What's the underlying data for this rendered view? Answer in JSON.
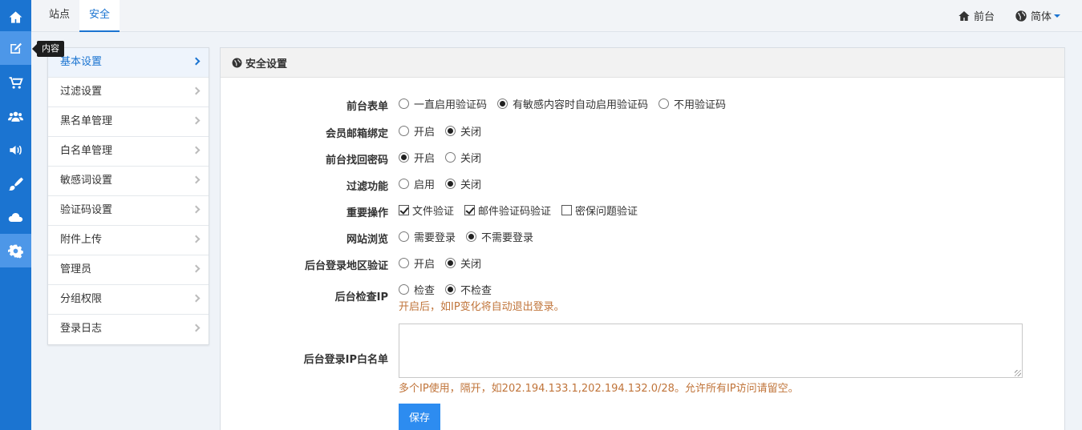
{
  "sidebar": {
    "icons": [
      "home-icon",
      "edit-icon",
      "cart-icon",
      "users-icon",
      "volume-icon",
      "brush-icon",
      "cloud-icon",
      "gear-icon"
    ],
    "tooltip": "内容"
  },
  "topbar": {
    "tabs": [
      {
        "label": "站点"
      },
      {
        "label": "安全"
      }
    ],
    "frontend": "前台",
    "language": "简体"
  },
  "submenu": {
    "items": [
      {
        "label": "基本设置"
      },
      {
        "label": "过滤设置"
      },
      {
        "label": "黑名单管理"
      },
      {
        "label": "白名单管理"
      },
      {
        "label": "敏感词设置"
      },
      {
        "label": "验证码设置"
      },
      {
        "label": "附件上传"
      },
      {
        "label": "管理员"
      },
      {
        "label": "分组权限"
      },
      {
        "label": "登录日志"
      }
    ]
  },
  "panel": {
    "title": "安全设置",
    "rows": [
      {
        "label": "前台表单",
        "options": [
          "一直启用验证码",
          "有敏感内容时自动启用验证码",
          "不用验证码"
        ],
        "selected": 1
      },
      {
        "label": "会员邮箱绑定",
        "options": [
          "开启",
          "关闭"
        ],
        "selected": 1
      },
      {
        "label": "前台找回密码",
        "options": [
          "开启",
          "关闭"
        ],
        "selected": 0
      },
      {
        "label": "过滤功能",
        "options": [
          "启用",
          "关闭"
        ],
        "selected": 1
      },
      {
        "label": "重要操作",
        "checkboxes": [
          "文件验证",
          "邮件验证码验证",
          "密保问题验证"
        ],
        "checked": [
          true,
          true,
          false
        ]
      },
      {
        "label": "网站浏览",
        "options": [
          "需要登录",
          "不需要登录"
        ],
        "selected": 1
      },
      {
        "label": "后台登录地区验证",
        "options": [
          "开启",
          "关闭"
        ],
        "selected": 1
      },
      {
        "label": "后台检查IP",
        "options": [
          "检查",
          "不检查"
        ],
        "selected": 1,
        "help": "开启后，如IP变化将自动退出登录。"
      }
    ],
    "ip_whitelist": {
      "label": "后台登录IP白名单",
      "value": "",
      "help": "多个IP使用，隔开，如202.194.133.1,202.194.132.0/28。允许所有IP访问请留空。"
    },
    "save_label": "保存"
  }
}
